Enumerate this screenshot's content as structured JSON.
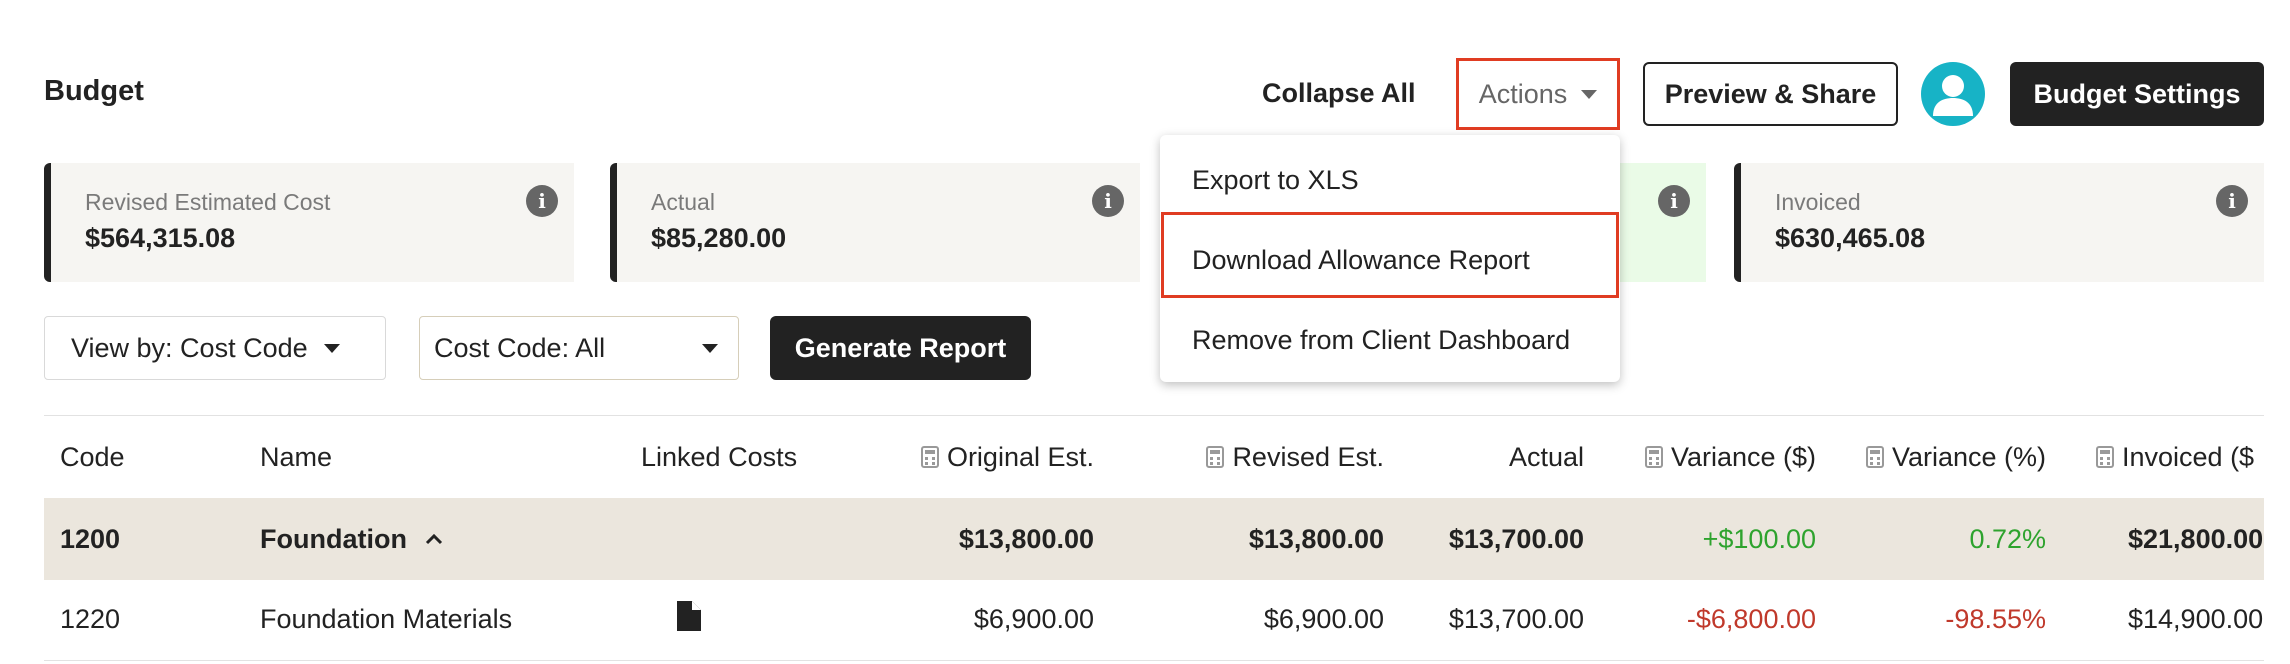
{
  "header": {
    "title": "Budget",
    "collapse_all": "Collapse All",
    "actions_label": "Actions",
    "preview_share": "Preview & Share",
    "budget_settings": "Budget Settings"
  },
  "cards": [
    {
      "label": "Revised Estimated Cost",
      "value": "$564,315.08"
    },
    {
      "label": "Actual",
      "value": "$85,280.00"
    },
    {
      "label": "",
      "value": ""
    },
    {
      "label": "Invoiced",
      "value": "$630,465.08"
    }
  ],
  "filters": {
    "view_by": "View by: Cost Code",
    "cost_code": "Cost Code: All",
    "generate_report": "Generate Report"
  },
  "actions_menu": {
    "items": [
      "Export to XLS",
      "Download Allowance Report",
      "Remove from Client Dashboard"
    ]
  },
  "table": {
    "columns": [
      "Code",
      "Name",
      "Linked Costs",
      "Original Est.",
      "Revised Est.",
      "Actual",
      "Variance ($)",
      "Variance (%)",
      "Invoiced ($"
    ],
    "rows": [
      {
        "code": "1200",
        "name": "Foundation",
        "original": "$13,800.00",
        "revised": "$13,800.00",
        "actual": "$13,700.00",
        "variance": "+$100.00",
        "variance_pct": "0.72%",
        "invoiced": "$21,800.00"
      },
      {
        "code": "1220",
        "name": "Foundation Materials",
        "original": "$6,900.00",
        "revised": "$6,900.00",
        "actual": "$13,700.00",
        "variance": "-$6,800.00",
        "variance_pct": "-98.55%",
        "invoiced": "$14,900.00"
      }
    ]
  },
  "colors": {
    "highlight": "#e03c22",
    "positive": "#2ea32e",
    "negative": "#c0392b",
    "avatar": "#17b3c6"
  }
}
